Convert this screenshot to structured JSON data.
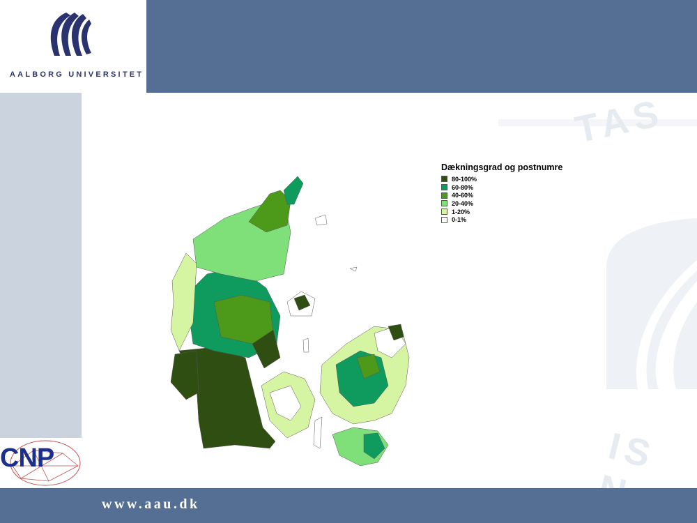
{
  "header": {
    "university": "AALBORG UNIVERSITET"
  },
  "footer": {
    "url": "www.aau.dk"
  },
  "logo_cnp": {
    "text": "CNP"
  },
  "watermark": {
    "top_text": "TAS",
    "bottom_text": "IS N"
  },
  "legend": {
    "title": "Dækningsgrad og postnumre",
    "items": [
      {
        "label": "80-100%",
        "color": "#2f4f12"
      },
      {
        "label": "60-80%",
        "color": "#0f9b5e"
      },
      {
        "label": "40-60%",
        "color": "#4d9a1a"
      },
      {
        "label": "20-40%",
        "color": "#7fe07a"
      },
      {
        "label": "1-20%",
        "color": "#d6f5a3"
      },
      {
        "label": "0-1%",
        "color": "#ffffff"
      }
    ]
  },
  "colors": {
    "brand_blue": "#546f93",
    "side_band": "#cbd3df",
    "logo_navy": "#2a3370"
  }
}
